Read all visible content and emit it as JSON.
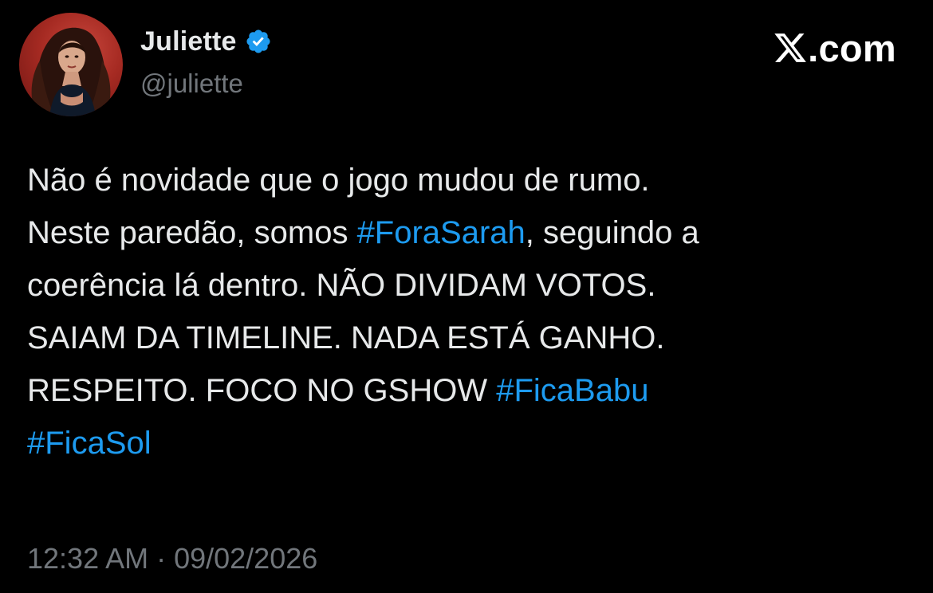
{
  "author": {
    "display_name": "Juliette",
    "handle": "@juliette",
    "verified_icon": "verified-badge-icon",
    "avatar": "profile-photo"
  },
  "brand": {
    "icon": "x-logo-icon",
    "domain": ".com"
  },
  "tweet": {
    "lines": [
      {
        "text": "Não é novidade que o jogo mudou de rumo."
      },
      {
        "before": "Neste paredão, somos ",
        "hashtag": "#ForaSarah",
        "after": ", seguindo a"
      },
      {
        "text": "coerência lá dentro. NÃO DIVIDAM VOTOS."
      },
      {
        "text": "SAIAM DA TIMELINE. NADA ESTÁ GANHO."
      },
      {
        "before": "RESPEITO. FOCO NO GSHOW ",
        "hashtag": "#FicaBabu"
      },
      {
        "hashtag": "#FicaSol"
      }
    ]
  },
  "meta": {
    "timestamp": "12:32 AM · 09/02/2026"
  },
  "colors": {
    "background": "#000000",
    "text": "#e7e9ea",
    "secondary_text": "#71767b",
    "hashtag": "#1d9bf0",
    "verified": "#1d9bf0"
  }
}
